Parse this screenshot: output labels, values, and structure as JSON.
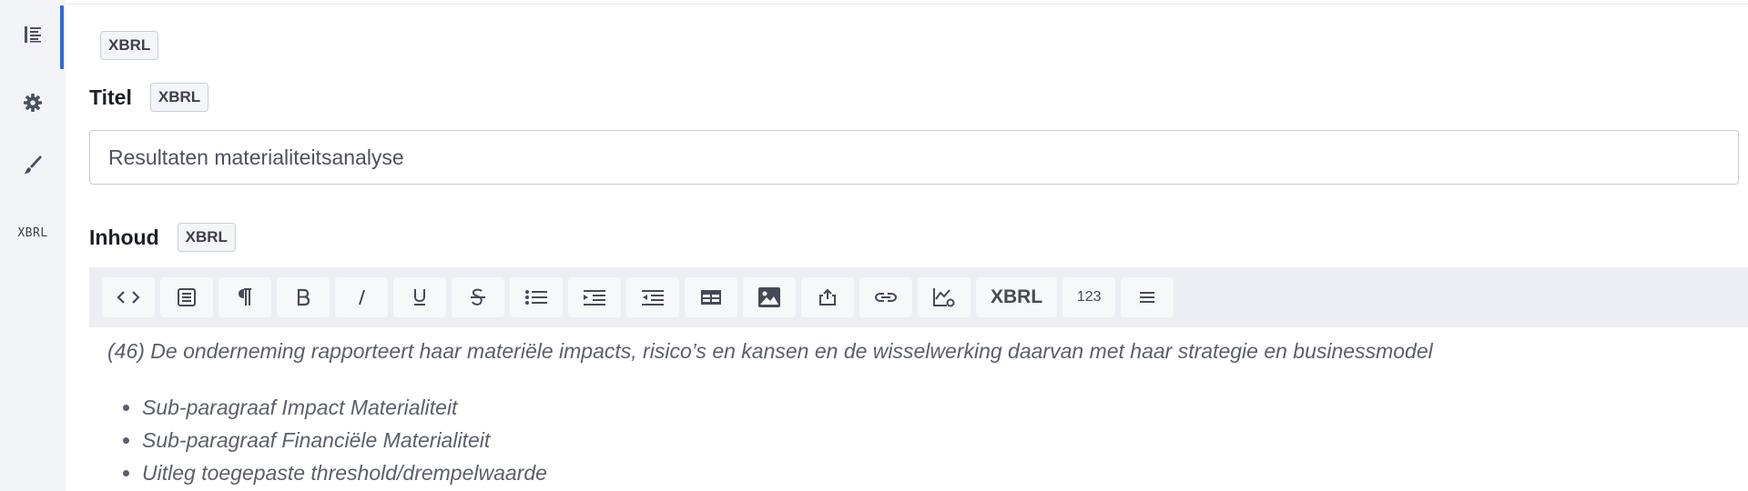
{
  "sidebar": {
    "items": [
      {
        "icon": "list-icon",
        "active": true
      },
      {
        "icon": "gear-icon",
        "active": false
      },
      {
        "icon": "brush-icon",
        "active": false
      },
      {
        "icon": "xbrl-text",
        "label": "XBRL",
        "active": false
      }
    ],
    "accent_color": "#2b6cdb"
  },
  "main": {
    "top_badge": "XBRL",
    "title_field": {
      "label": "Titel",
      "badge": "XBRL",
      "value": "Resultaten materialiteitsanalyse"
    },
    "content_field": {
      "label": "Inhoud",
      "badge": "XBRL"
    },
    "toolbar": {
      "buttons": [
        {
          "name": "source-code-icon"
        },
        {
          "name": "format-block-icon"
        },
        {
          "name": "paragraph-icon"
        },
        {
          "name": "bold-icon"
        },
        {
          "name": "italic-icon"
        },
        {
          "name": "underline-icon"
        },
        {
          "name": "strikethrough-icon"
        },
        {
          "name": "bullet-list-icon"
        },
        {
          "name": "indent-icon"
        },
        {
          "name": "outdent-icon"
        },
        {
          "name": "table-icon"
        },
        {
          "name": "image-icon"
        },
        {
          "name": "upload-icon"
        },
        {
          "name": "link-icon"
        },
        {
          "name": "chart-icon"
        }
      ],
      "xbrl_label": "XBRL",
      "number_label": "123",
      "menu_icon": "menu-icon"
    },
    "editor": {
      "paragraph": "(46) De onderneming rapporteert haar materiële impacts, risico’s en kansen en de wisselwerking daarvan met haar strategie en businessmodel",
      "list_items": [
        "Sub-paragraaf Impact Materialiteit",
        "Sub-paragraaf Financiële Materialiteit",
        "Uitleg toegepaste threshold/drempelwaarde"
      ]
    }
  }
}
